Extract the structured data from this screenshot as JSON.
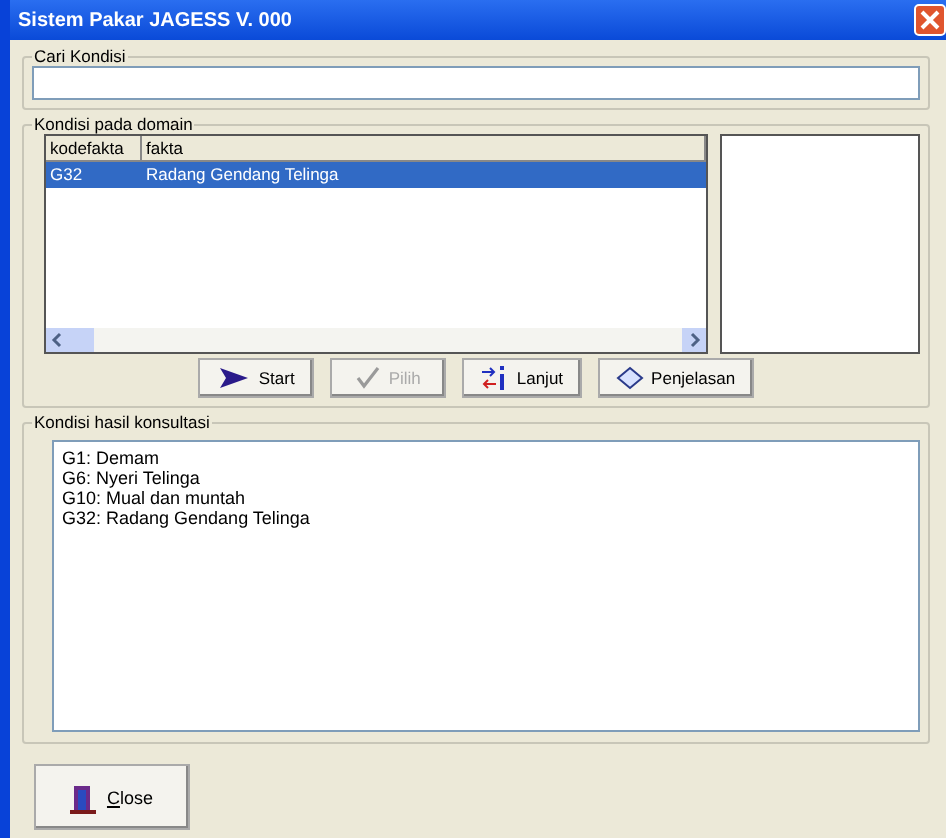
{
  "window": {
    "title": "Sistem Pakar JAGESS V. 000"
  },
  "search": {
    "label": "Cari Kondisi"
  },
  "domain": {
    "label": "Kondisi pada domain",
    "columns": [
      "kodefakta",
      "fakta"
    ],
    "rows": [
      {
        "cells": [
          "G32",
          "Radang Gendang Telinga"
        ],
        "selected": true
      }
    ]
  },
  "buttons": [
    {
      "kind": "start",
      "label": "Start",
      "disabled": false
    },
    {
      "kind": "check",
      "label": "Pilih",
      "disabled": true
    },
    {
      "kind": "next",
      "label": "Lanjut",
      "disabled": false
    },
    {
      "kind": "explain",
      "label": "Penjelasan",
      "disabled": false
    }
  ],
  "results": {
    "label": "Kondisi hasil konsultasi",
    "lines": [
      "G1: Demam",
      "G6: Nyeri Telinga",
      "G10: Mual dan muntah",
      "G32: Radang Gendang Telinga"
    ]
  },
  "close_button": {
    "label": "Close",
    "first_letter_underlined": true
  }
}
